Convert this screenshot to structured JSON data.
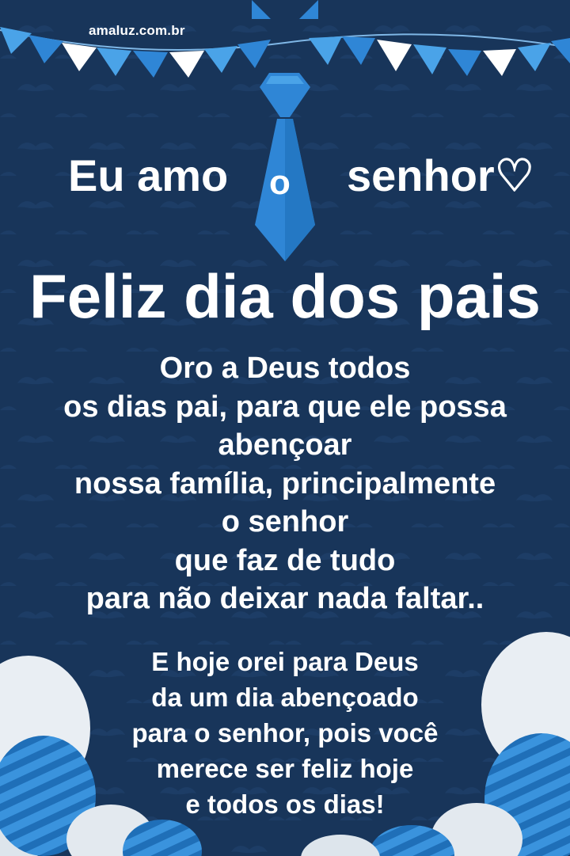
{
  "site": "amaluz.com.br",
  "love": {
    "part1": "Eu amo",
    "part2": "o",
    "part3": "senhor♡"
  },
  "title": "Feliz dia dos pais",
  "paragraph1": [
    "Oro a Deus todos",
    "os dias pai, para que ele possa",
    "abençoar",
    "nossa família, principalmente",
    "o senhor",
    "que faz de tudo",
    "para não deixar nada faltar.."
  ],
  "paragraph2": [
    "E hoje orei para Deus",
    "da um dia abençoado",
    "para o senhor, pois você",
    "merece ser feliz hoje",
    "e todos os dias!"
  ],
  "colors": {
    "background": "#18355a",
    "accent_blue": "#2f86d6",
    "light_blue": "#4aa3e8",
    "text": "#ffffff"
  },
  "icons": [
    "mustache-icon",
    "tie-icon",
    "balloon-icon",
    "bunting-flag-icon",
    "heart-icon"
  ]
}
